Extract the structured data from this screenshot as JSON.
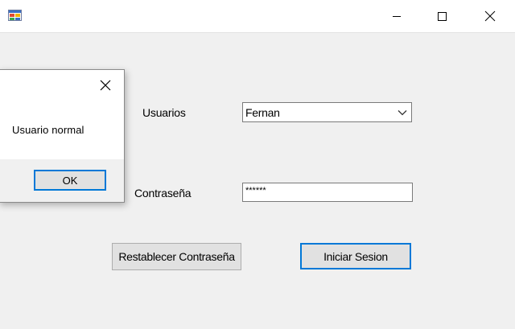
{
  "window": {
    "title": "",
    "icon": "winforms-app-icon",
    "controls": {
      "minimize_icon": "minimize-icon",
      "maximize_icon": "maximize-icon",
      "close_icon": "close-icon"
    }
  },
  "form": {
    "user_label": "Usuarios",
    "user_combo_value": "Fernan",
    "password_label": "Contraseña",
    "password_value": "******",
    "reset_button": "Restablecer Contraseña",
    "login_button": "Iniciar Sesion"
  },
  "message_box": {
    "message": "Usuario normal",
    "ok_button": "OK"
  },
  "colors": {
    "accent": "#0078d7",
    "background": "#f0f0f0"
  }
}
